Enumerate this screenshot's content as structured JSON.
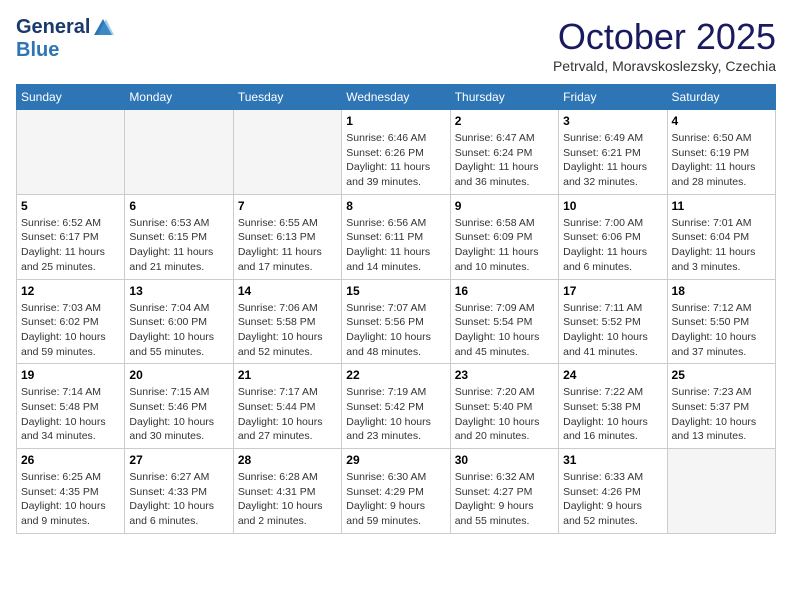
{
  "header": {
    "logo_line1": "General",
    "logo_line2": "Blue",
    "month_title": "October 2025",
    "location": "Petrvald, Moravskoslezsky, Czechia"
  },
  "days_of_week": [
    "Sunday",
    "Monday",
    "Tuesday",
    "Wednesday",
    "Thursday",
    "Friday",
    "Saturday"
  ],
  "weeks": [
    [
      {
        "day": "",
        "info": ""
      },
      {
        "day": "",
        "info": ""
      },
      {
        "day": "",
        "info": ""
      },
      {
        "day": "1",
        "info": "Sunrise: 6:46 AM\nSunset: 6:26 PM\nDaylight: 11 hours\nand 39 minutes."
      },
      {
        "day": "2",
        "info": "Sunrise: 6:47 AM\nSunset: 6:24 PM\nDaylight: 11 hours\nand 36 minutes."
      },
      {
        "day": "3",
        "info": "Sunrise: 6:49 AM\nSunset: 6:21 PM\nDaylight: 11 hours\nand 32 minutes."
      },
      {
        "day": "4",
        "info": "Sunrise: 6:50 AM\nSunset: 6:19 PM\nDaylight: 11 hours\nand 28 minutes."
      }
    ],
    [
      {
        "day": "5",
        "info": "Sunrise: 6:52 AM\nSunset: 6:17 PM\nDaylight: 11 hours\nand 25 minutes."
      },
      {
        "day": "6",
        "info": "Sunrise: 6:53 AM\nSunset: 6:15 PM\nDaylight: 11 hours\nand 21 minutes."
      },
      {
        "day": "7",
        "info": "Sunrise: 6:55 AM\nSunset: 6:13 PM\nDaylight: 11 hours\nand 17 minutes."
      },
      {
        "day": "8",
        "info": "Sunrise: 6:56 AM\nSunset: 6:11 PM\nDaylight: 11 hours\nand 14 minutes."
      },
      {
        "day": "9",
        "info": "Sunrise: 6:58 AM\nSunset: 6:09 PM\nDaylight: 11 hours\nand 10 minutes."
      },
      {
        "day": "10",
        "info": "Sunrise: 7:00 AM\nSunset: 6:06 PM\nDaylight: 11 hours\nand 6 minutes."
      },
      {
        "day": "11",
        "info": "Sunrise: 7:01 AM\nSunset: 6:04 PM\nDaylight: 11 hours\nand 3 minutes."
      }
    ],
    [
      {
        "day": "12",
        "info": "Sunrise: 7:03 AM\nSunset: 6:02 PM\nDaylight: 10 hours\nand 59 minutes."
      },
      {
        "day": "13",
        "info": "Sunrise: 7:04 AM\nSunset: 6:00 PM\nDaylight: 10 hours\nand 55 minutes."
      },
      {
        "day": "14",
        "info": "Sunrise: 7:06 AM\nSunset: 5:58 PM\nDaylight: 10 hours\nand 52 minutes."
      },
      {
        "day": "15",
        "info": "Sunrise: 7:07 AM\nSunset: 5:56 PM\nDaylight: 10 hours\nand 48 minutes."
      },
      {
        "day": "16",
        "info": "Sunrise: 7:09 AM\nSunset: 5:54 PM\nDaylight: 10 hours\nand 45 minutes."
      },
      {
        "day": "17",
        "info": "Sunrise: 7:11 AM\nSunset: 5:52 PM\nDaylight: 10 hours\nand 41 minutes."
      },
      {
        "day": "18",
        "info": "Sunrise: 7:12 AM\nSunset: 5:50 PM\nDaylight: 10 hours\nand 37 minutes."
      }
    ],
    [
      {
        "day": "19",
        "info": "Sunrise: 7:14 AM\nSunset: 5:48 PM\nDaylight: 10 hours\nand 34 minutes."
      },
      {
        "day": "20",
        "info": "Sunrise: 7:15 AM\nSunset: 5:46 PM\nDaylight: 10 hours\nand 30 minutes."
      },
      {
        "day": "21",
        "info": "Sunrise: 7:17 AM\nSunset: 5:44 PM\nDaylight: 10 hours\nand 27 minutes."
      },
      {
        "day": "22",
        "info": "Sunrise: 7:19 AM\nSunset: 5:42 PM\nDaylight: 10 hours\nand 23 minutes."
      },
      {
        "day": "23",
        "info": "Sunrise: 7:20 AM\nSunset: 5:40 PM\nDaylight: 10 hours\nand 20 minutes."
      },
      {
        "day": "24",
        "info": "Sunrise: 7:22 AM\nSunset: 5:38 PM\nDaylight: 10 hours\nand 16 minutes."
      },
      {
        "day": "25",
        "info": "Sunrise: 7:23 AM\nSunset: 5:37 PM\nDaylight: 10 hours\nand 13 minutes."
      }
    ],
    [
      {
        "day": "26",
        "info": "Sunrise: 6:25 AM\nSunset: 4:35 PM\nDaylight: 10 hours\nand 9 minutes."
      },
      {
        "day": "27",
        "info": "Sunrise: 6:27 AM\nSunset: 4:33 PM\nDaylight: 10 hours\nand 6 minutes."
      },
      {
        "day": "28",
        "info": "Sunrise: 6:28 AM\nSunset: 4:31 PM\nDaylight: 10 hours\nand 2 minutes."
      },
      {
        "day": "29",
        "info": "Sunrise: 6:30 AM\nSunset: 4:29 PM\nDaylight: 9 hours\nand 59 minutes."
      },
      {
        "day": "30",
        "info": "Sunrise: 6:32 AM\nSunset: 4:27 PM\nDaylight: 9 hours\nand 55 minutes."
      },
      {
        "day": "31",
        "info": "Sunrise: 6:33 AM\nSunset: 4:26 PM\nDaylight: 9 hours\nand 52 minutes."
      },
      {
        "day": "",
        "info": ""
      }
    ]
  ]
}
